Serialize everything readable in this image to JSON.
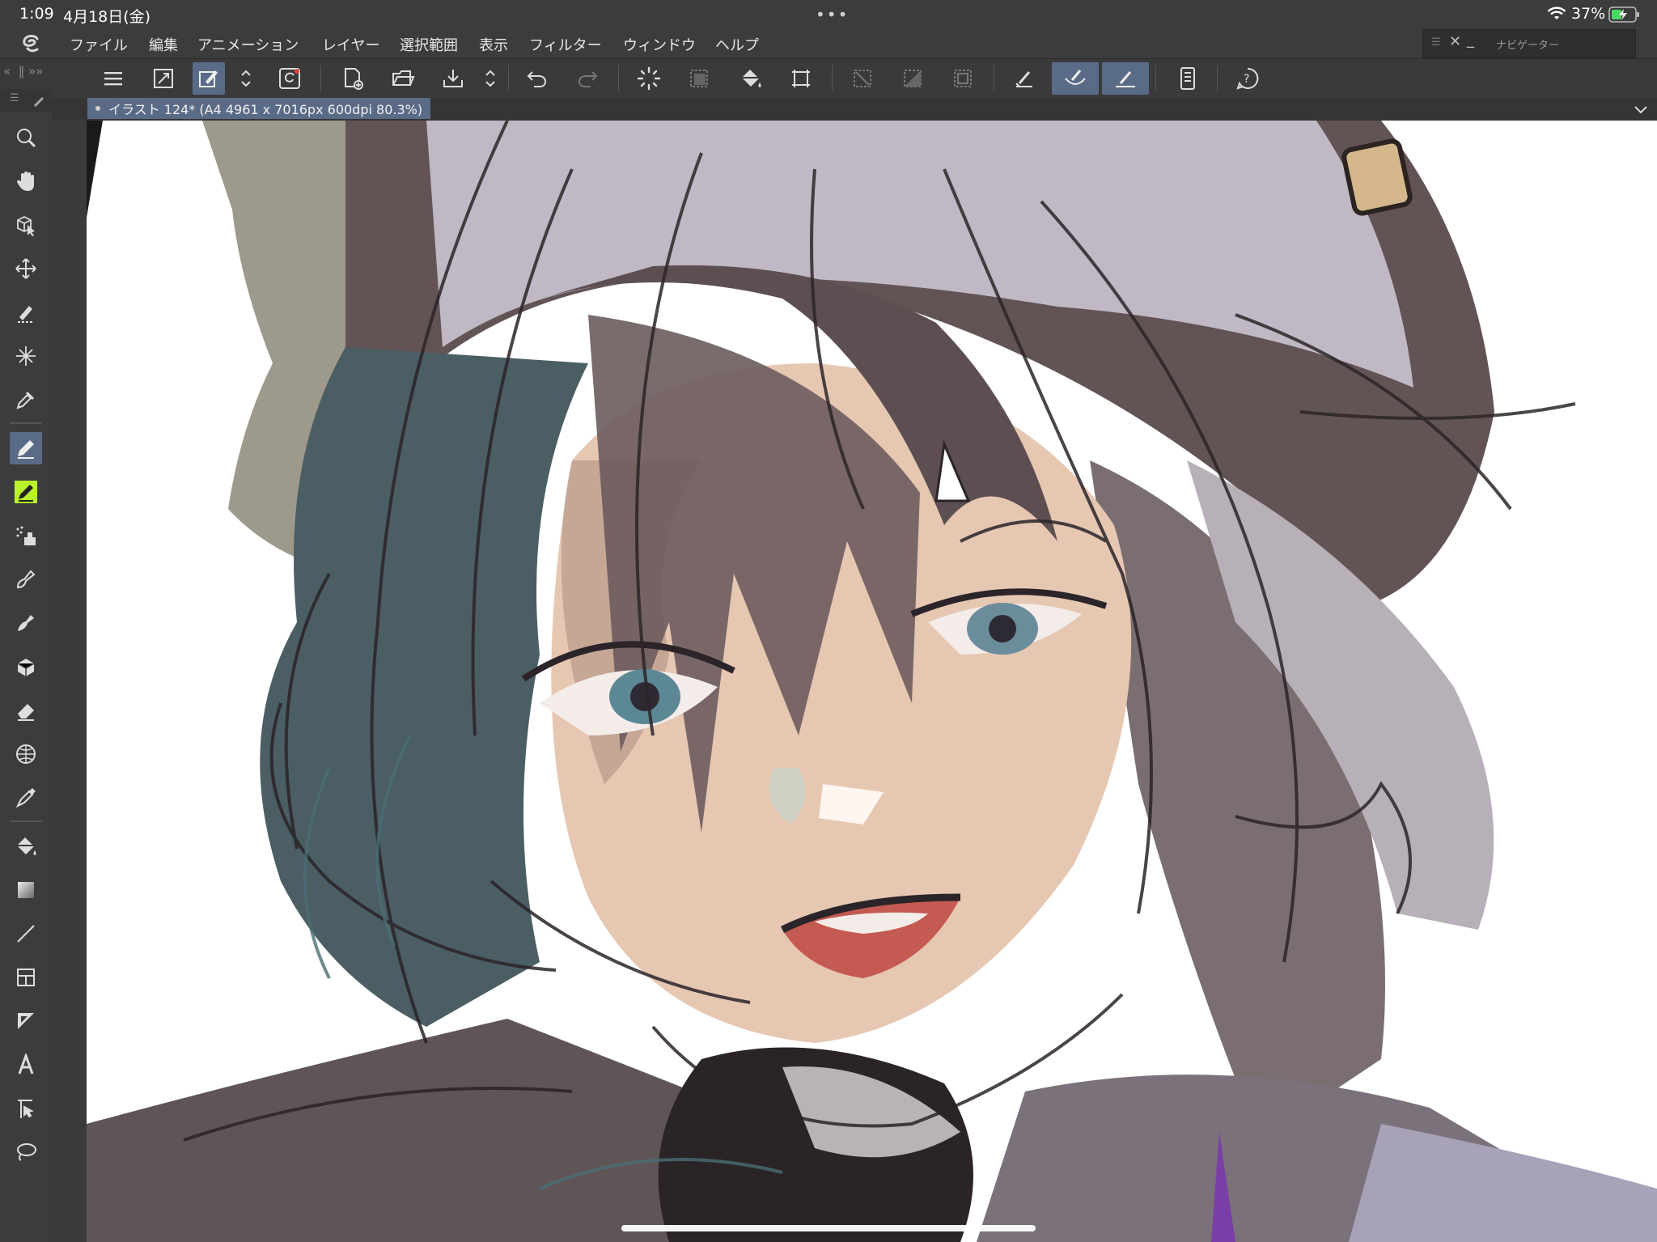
{
  "status_bar": {
    "time": "1:09",
    "date": "4月18日(金)",
    "battery": "37%",
    "dots": "•••"
  },
  "menu": {
    "items": [
      "ファイル",
      "編集",
      "アニメーション",
      "レイヤー",
      "選択範囲",
      "表示",
      "フィルター",
      "ウィンドウ",
      "ヘルプ"
    ]
  },
  "navigator": {
    "title": "ナビゲーター"
  },
  "document": {
    "tab_title": "イラスト 124* (A4 4961 x 7016px 600dpi 80.3%)"
  },
  "command_bar": {
    "icons": [
      "menu-icon",
      "canvas-resize-icon",
      "edit-mode-icon",
      "stepper-icon",
      "clip-studio-icon",
      "new-file-icon",
      "open-file-icon",
      "save-icon",
      "stepper-icon",
      "undo-icon",
      "redo-icon",
      "loading-icon",
      "clear-icon",
      "fill-icon",
      "transform-icon",
      "deselect-icon",
      "invert-selection-icon",
      "show-selection-icon",
      "snap-to-ruler-icon",
      "snap-to-perspective-icon",
      "snap-to-special-ruler-icon",
      "device-settings-icon",
      "help-icon"
    ]
  },
  "tools": [
    "zoom-icon",
    "hand-icon",
    "operation-icon",
    "move-layer-icon",
    "selection-icon",
    "auto-select-icon",
    "eyedropper-icon",
    "pen-icon",
    "pencil-icon",
    "airbrush-icon",
    "brush-icon",
    "decoration-icon",
    "blend-icon",
    "eraser-icon",
    "figure-icon",
    "gradient-icon",
    "fill-icon",
    "gradient-icon",
    "line-icon",
    "frame-icon",
    "ruler-icon",
    "text-icon",
    "balloon-icon",
    "lasso-icon"
  ],
  "colors": {
    "accent": "#5a6b87",
    "chrome": "#3c3c3c",
    "canvas": "#ffffff",
    "pencil_highlight": "#b8f32a"
  }
}
